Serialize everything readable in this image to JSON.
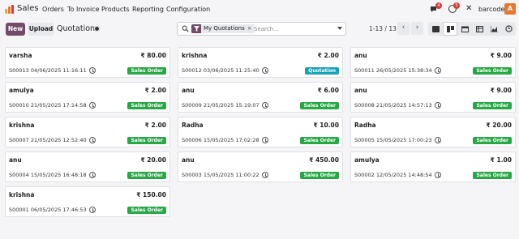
{
  "navbar": {
    "app_name": "Sales",
    "menu": [
      "Orders",
      "To Invoice",
      "Products",
      "Reporting",
      "Configuration"
    ],
    "chat_badge": "4",
    "activity_badge": "5",
    "company": "barcode",
    "avatar_letter": "A"
  },
  "control": {
    "new_label": "New",
    "upload_label": "Upload",
    "title": "Quotations",
    "facet_label": "My Quotations",
    "search_placeholder": "Search...",
    "pager": "1-13 / 13"
  },
  "colors": {
    "brand": "#714b67",
    "sales_order": "#28a745",
    "quotation": "#17a2b8"
  },
  "cards": [
    {
      "name": "varsha",
      "amount": "₹ 80.00",
      "ref": "S00013 04/06/2025 11:16:11",
      "status": "Sales Order"
    },
    {
      "name": "krishna",
      "amount": "₹ 2.00",
      "ref": "S00012 03/06/2025 11:25:40",
      "status": "Quotation"
    },
    {
      "name": "anu",
      "amount": "₹ 9.00",
      "ref": "S00011 26/05/2025 15:38:34",
      "status": "Sales Order"
    },
    {
      "name": "amulya",
      "amount": "₹ 2.00",
      "ref": "S00010 21/05/2025 17:14:58",
      "status": "Sales Order"
    },
    {
      "name": "anu",
      "amount": "₹ 6.00",
      "ref": "S00009 21/05/2025 15:19:07",
      "status": "Sales Order"
    },
    {
      "name": "anu",
      "amount": "₹ 9.00",
      "ref": "S00008 21/05/2025 14:57:13",
      "status": "Sales Order"
    },
    {
      "name": "krishna",
      "amount": "₹ 2.00",
      "ref": "S00007 21/05/2025 12:52:40",
      "status": "Sales Order"
    },
    {
      "name": "Radha",
      "amount": "₹ 10.00",
      "ref": "S00006 15/05/2025 17:02:28",
      "status": "Sales Order"
    },
    {
      "name": "Radha",
      "amount": "₹ 20.00",
      "ref": "S00005 15/05/2025 17:00:23",
      "status": "Sales Order"
    },
    {
      "name": "anu",
      "amount": "₹ 20.00",
      "ref": "S00004 15/05/2025 16:48:18",
      "status": "Sales Order"
    },
    {
      "name": "anu",
      "amount": "₹ 450.00",
      "ref": "S00003 15/05/2025 11:00:22",
      "status": "Sales Order"
    },
    {
      "name": "amulya",
      "amount": "₹ 1.00",
      "ref": "S00002 12/05/2025 14:48:54",
      "status": "Sales Order"
    },
    {
      "name": "krishna",
      "amount": "₹ 150.00",
      "ref": "S00001 06/05/2025 17:46:53",
      "status": "Sales Order"
    }
  ]
}
